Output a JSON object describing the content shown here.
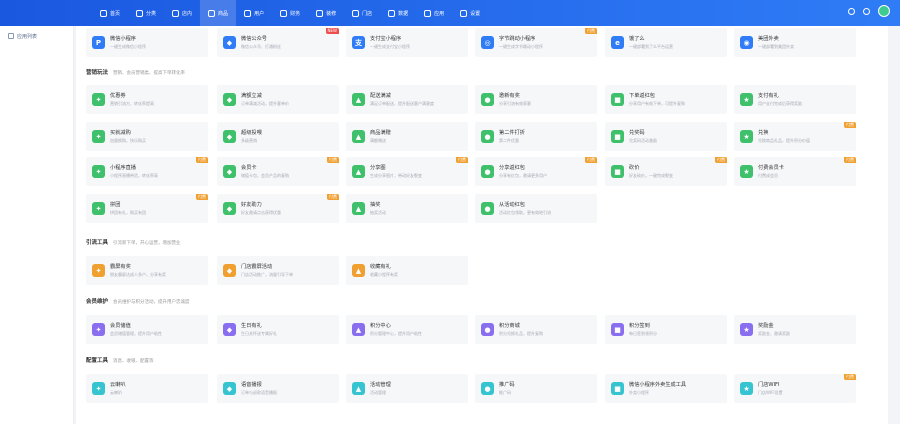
{
  "nav": [
    {
      "label": "首页",
      "active": false,
      "icon": "home-icon"
    },
    {
      "label": "分类",
      "active": false,
      "icon": "category-icon"
    },
    {
      "label": "店内",
      "active": false,
      "icon": "store-icon"
    },
    {
      "label": "商品",
      "active": true,
      "icon": "goods-icon"
    },
    {
      "label": "用户",
      "active": false,
      "icon": "user-icon"
    },
    {
      "label": "财务",
      "active": false,
      "icon": "finance-icon"
    },
    {
      "label": "装修",
      "active": false,
      "icon": "decorate-icon"
    },
    {
      "label": "门店",
      "active": false,
      "icon": "shop-icon"
    },
    {
      "label": "数据",
      "active": false,
      "icon": "data-icon"
    },
    {
      "label": "应用",
      "active": false,
      "icon": "app-icon"
    },
    {
      "label": "设置",
      "active": false,
      "icon": "settings-icon"
    }
  ],
  "sidebar": {
    "items": [
      {
        "label": "应用列表"
      }
    ]
  },
  "top_channels": [
    {
      "title": "微信小程序",
      "desc": "一键生成微信小程序",
      "color": "#2f7cf6",
      "glyph": "P",
      "badge": ""
    },
    {
      "title": "微信公众号",
      "desc": "微信公众号、打通粉丝",
      "color": "#2f7cf6",
      "glyph": "◆",
      "badge": "NEW"
    },
    {
      "title": "支付宝小程序",
      "desc": "一键生成支付宝小程序",
      "color": "#2f7cf6",
      "glyph": "支",
      "badge": ""
    },
    {
      "title": "字节跳动小程序",
      "desc": "一键生成字节跳动小程序",
      "color": "#2f7cf6",
      "glyph": "◎",
      "badge": "付费"
    },
    {
      "title": "饿了么",
      "desc": "一键部署到了么平台运营",
      "color": "#2f7cf6",
      "glyph": "e",
      "badge": ""
    },
    {
      "title": "美团外卖",
      "desc": "一键部署到美团外卖",
      "color": "#2f7cf6",
      "glyph": "◉",
      "badge": ""
    }
  ],
  "sections": [
    {
      "title": "营销玩法",
      "sub": "营销、会员营销类、提高下单转化率",
      "rows": [
        [
          {
            "title": "优惠券",
            "desc": "营销引流方、转化率提高",
            "color": "#3fc06a",
            "badge": ""
          },
          {
            "title": "满额立减",
            "desc": "订单满减活动，提升客单价",
            "color": "#3fc06a",
            "badge": ""
          },
          {
            "title": "配送满减",
            "desc": "满足订单配送、提升配送客户满意度",
            "color": "#3fc06a",
            "badge": ""
          },
          {
            "title": "邀新有奖",
            "desc": "分享引流有效获客",
            "color": "#3fc06a",
            "badge": ""
          },
          {
            "title": "下单返红包",
            "desc": "分享用户有效下单，可提升复购",
            "color": "#3fc06a",
            "badge": ""
          },
          {
            "title": "支付有礼",
            "desc": "用户支付完成后获得奖励",
            "color": "#3fc06a",
            "badge": ""
          }
        ],
        [
          {
            "title": "买就减购",
            "desc": "加量换购，快乐购买",
            "color": "#3fc06a",
            "badge": ""
          },
          {
            "title": "超级投喂",
            "desc": "多级营销",
            "color": "#3fc06a",
            "badge": ""
          },
          {
            "title": "商品满赠",
            "desc": "满额赠送",
            "color": "#3fc06a",
            "badge": ""
          },
          {
            "title": "第二件打折",
            "desc": "第二件优惠",
            "color": "#3fc06a",
            "badge": ""
          },
          {
            "title": "兑奖码",
            "desc": "兑奖码活动激励",
            "color": "#3fc06a",
            "badge": ""
          },
          {
            "title": "兑换",
            "desc": "兑换商品礼品，提升积分价值",
            "color": "#3fc06a",
            "badge": "付费"
          }
        ],
        [
          {
            "title": "小程序直播",
            "desc": "小程序直播带货，转化率高",
            "color": "#3fc06a",
            "badge": "付费"
          },
          {
            "title": "会员卡",
            "desc": "储值卡包，会员产品的复购",
            "color": "#3fc06a",
            "badge": "付费"
          },
          {
            "title": "分享图",
            "desc": "生成分享图片，带动好友裂变",
            "color": "#3fc06a",
            "badge": "付费"
          },
          {
            "title": "分享返红包",
            "desc": "分享有红包，邀请更多用户",
            "color": "#3fc06a",
            "badge": "付费"
          },
          {
            "title": "砍价",
            "desc": "好友砍价，一键完成裂变",
            "color": "#3fc06a",
            "badge": "付费"
          },
          {
            "title": "付费会员卡",
            "desc": "付费成会员",
            "color": "#3fc06a",
            "badge": "付费"
          }
        ],
        [
          {
            "title": "拼团",
            "desc": "拼团有礼，购买有团",
            "color": "#3fc06a",
            "badge": "付费"
          },
          {
            "title": "好友助力",
            "desc": "好友邀请点击获得优惠",
            "color": "#3fc06a",
            "badge": "付费"
          },
          {
            "title": "抽奖",
            "desc": "抽奖活动",
            "color": "#3fc06a",
            "badge": ""
          },
          {
            "title": "从活动红包",
            "desc": "活动红包领取，更有效地引流",
            "color": "#3fc06a",
            "badge": ""
          }
        ]
      ]
    },
    {
      "title": "引流工具",
      "sub": "引流新下单，开心运营，增加营业",
      "rows": [
        [
          {
            "title": "霸屏有奖",
            "desc": "朋友霸屏达成人多户，分享有奖",
            "color": "#f0a030",
            "badge": ""
          },
          {
            "title": "门店霸屏活动",
            "desc": "门店活动推广，流量引导下单",
            "color": "#f0a030",
            "badge": ""
          },
          {
            "title": "收藏有礼",
            "desc": "收藏小程序有奖",
            "color": "#f0a030",
            "badge": ""
          }
        ]
      ]
    },
    {
      "title": "会员维护",
      "sub": "会员维护与积分活动，提升用户忠诚度",
      "rows": [
        [
          {
            "title": "会员储值",
            "desc": "会员储值管理，提升用户粘性",
            "color": "#8a6ef0",
            "badge": ""
          },
          {
            "title": "生日有礼",
            "desc": "生日关怀送专属好礼",
            "color": "#8a6ef0",
            "badge": ""
          },
          {
            "title": "积分中心",
            "desc": "积分管理中心，提升用户粘性",
            "color": "#8a6ef0",
            "badge": ""
          },
          {
            "title": "积分商城",
            "desc": "积分兑换礼品，提升复购",
            "color": "#8a6ef0",
            "badge": ""
          },
          {
            "title": "积分签到",
            "desc": "每日签到领积分",
            "color": "#8a6ef0",
            "badge": ""
          },
          {
            "title": "奖励金",
            "desc": "奖励金、邀请奖励",
            "color": "#8a6ef0",
            "badge": ""
          }
        ]
      ]
    },
    {
      "title": "配置工具",
      "sub": "消息、收银、配置等",
      "rows": [
        [
          {
            "title": "云喇叭",
            "desc": "云喇叭",
            "color": "#36c5d0",
            "badge": ""
          },
          {
            "title": "语音播报",
            "desc": "订单与退款语音播报",
            "color": "#36c5d0",
            "badge": ""
          },
          {
            "title": "活动管理",
            "desc": "活动管理",
            "color": "#36c5d0",
            "badge": ""
          },
          {
            "title": "推广码",
            "desc": "推广码",
            "color": "#36c5d0",
            "badge": ""
          },
          {
            "title": "微信小程序外卖生成工具",
            "desc": "外卖小程序",
            "color": "#36c5d0",
            "badge": ""
          },
          {
            "title": "门店WIFI",
            "desc": "门店WIFI设置",
            "color": "#36c5d0",
            "badge": "付费"
          }
        ]
      ]
    }
  ]
}
